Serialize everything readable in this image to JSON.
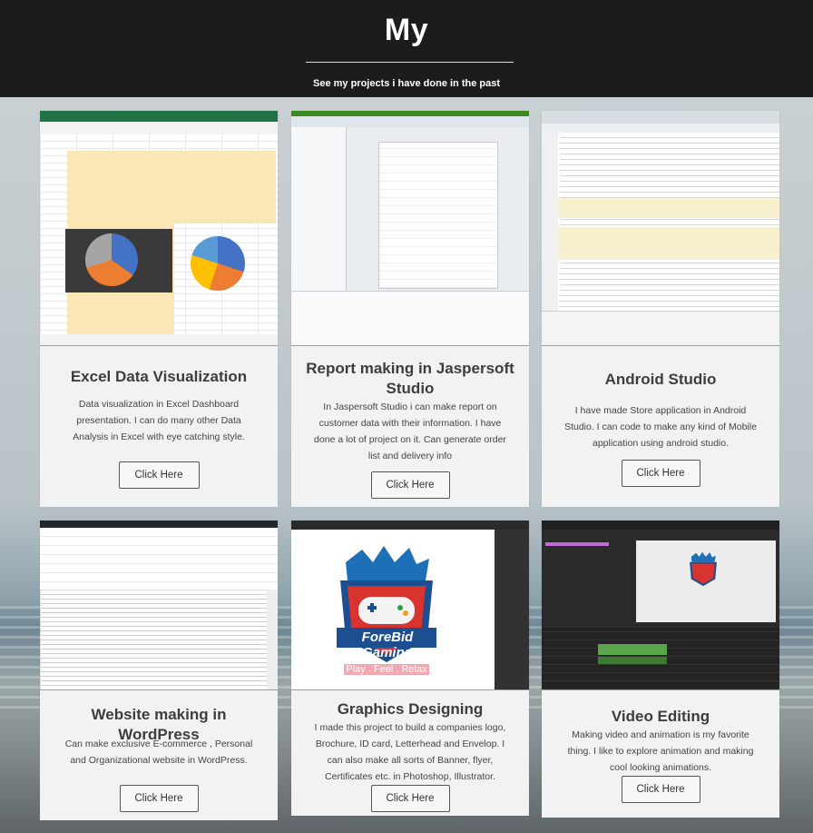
{
  "header": {
    "title": "My",
    "subtitle": "See my projects i have done in the past"
  },
  "cards": [
    {
      "title": "Excel Data Visualization",
      "description": "Data visualization in Excel Dashboard presentation. I can do many other Data Analysis in Excel with eye catching style.",
      "button": "Click Here",
      "image": "excel-dashboard-screenshot"
    },
    {
      "title": "Report making in Jaspersoft Studio",
      "description": "In Jaspersoft Studio i can make report on customer data with their information. I have done a lot of project on it. Can generate order list and delivery info",
      "button": "Click Here",
      "image": "jaspersoft-report-screenshot"
    },
    {
      "title": "Android Studio",
      "description": "I have made Store application in Android Studio. I can code to make any kind of Mobile application using android studio.",
      "button": "Click Here",
      "image": "android-studio-screenshot"
    },
    {
      "title": "Website making in WordPress",
      "description": "Can make exclusive E-commerce , Personal and Organizational website in WordPress.",
      "button": "Click Here",
      "image": "wordpress-editor-screenshot"
    },
    {
      "title": "Graphics Designing",
      "description": "I made this project to build a companies logo, Brochure, ID card, Letterhead and Envelop. I can also make all sorts of Banner, flyer, Certificates etc. in Photoshop, Illustrator.",
      "button": "Click Here",
      "image": "forebid-gaming-logo",
      "logo_text": "ForeBid Gaming",
      "logo_tagline": "Play . Feel . Relax"
    },
    {
      "title": "Video Editing",
      "description": "Making video and animation is my favorite thing. I like to explore animation and making cool looking animations.",
      "button": "Click Here",
      "image": "video-editor-screenshot"
    }
  ],
  "colors": {
    "header_bg": "#1c1c1c",
    "card_bg": "#f2f2f2",
    "title_text": "#3d3d3d"
  }
}
